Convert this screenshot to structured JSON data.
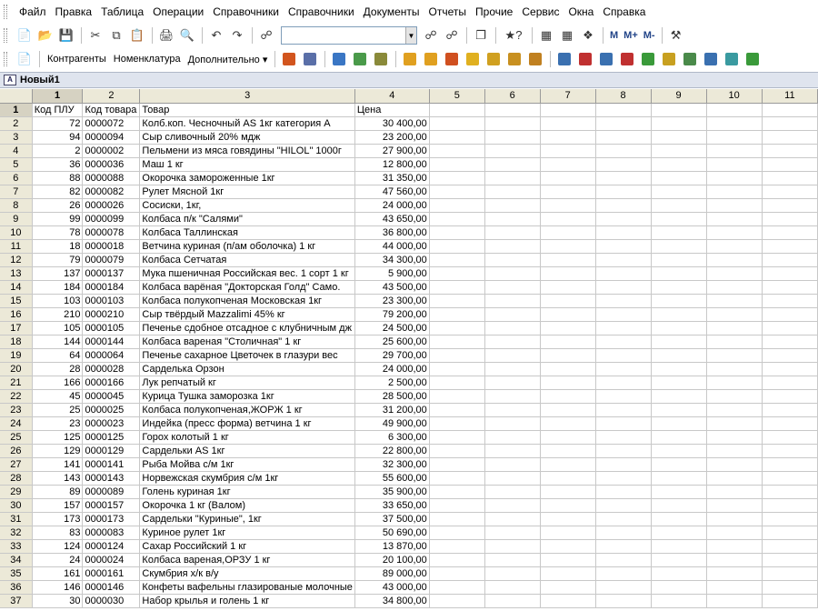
{
  "menu": [
    "Файл",
    "Правка",
    "Таблица",
    "Операции",
    "Справочники",
    "Справочники",
    "Документы",
    "Отчеты",
    "Прочие",
    "Сервис",
    "Окна",
    "Справка"
  ],
  "toolbar2": {
    "contractors": "Контрагенты",
    "nomenclature": "Номенклатура",
    "additional": "Дополнительно ▾"
  },
  "mbuttons": [
    "M",
    "M+",
    "M-"
  ],
  "document": {
    "title": "Новый1"
  },
  "columns": [
    "1",
    "2",
    "3",
    "4",
    "5",
    "6",
    "7",
    "8",
    "9",
    "10",
    "11"
  ],
  "header_row": {
    "num": "1",
    "cells": [
      "Код ПЛУ",
      "Код товара",
      "Товар",
      "Цена"
    ]
  },
  "rows": [
    {
      "n": "2",
      "plu": "72",
      "code": "0000072",
      "name": "Колб.коп. Чесночный AS 1кг категория А",
      "price": "30 400,00"
    },
    {
      "n": "3",
      "plu": "94",
      "code": "0000094",
      "name": "Сыр сливочный 20% мдж",
      "price": "23 200,00"
    },
    {
      "n": "4",
      "plu": "2",
      "code": "0000002",
      "name": "Пельмени из мяса говядины \"HILOL\" 1000г",
      "price": "27 900,00"
    },
    {
      "n": "5",
      "plu": "36",
      "code": "0000036",
      "name": "Маш 1 кг",
      "price": "12 800,00"
    },
    {
      "n": "6",
      "plu": "88",
      "code": "0000088",
      "name": "Окорочка замороженные 1кг",
      "price": "31 350,00"
    },
    {
      "n": "7",
      "plu": "82",
      "code": "0000082",
      "name": "Рулет Мясной 1кг",
      "price": "47 560,00"
    },
    {
      "n": "8",
      "plu": "26",
      "code": "0000026",
      "name": "Сосиски, 1кг,",
      "price": "24 000,00"
    },
    {
      "n": "9",
      "plu": "99",
      "code": "0000099",
      "name": "Колбаса п/к \"Салями\"",
      "price": "43 650,00"
    },
    {
      "n": "10",
      "plu": "78",
      "code": "0000078",
      "name": "Колбаса Таллинская",
      "price": "36 800,00"
    },
    {
      "n": "11",
      "plu": "18",
      "code": "0000018",
      "name": "Ветчина куриная (п/ам оболочка) 1 кг",
      "price": "44 000,00"
    },
    {
      "n": "12",
      "plu": "79",
      "code": "0000079",
      "name": "Колбаса Сетчатая",
      "price": "34 300,00"
    },
    {
      "n": "13",
      "plu": "137",
      "code": "0000137",
      "name": "Мука пшеничная Российская вес. 1 сорт 1 кг",
      "price": "5 900,00"
    },
    {
      "n": "14",
      "plu": "184",
      "code": "0000184",
      "name": "Колбаса варёная \"Докторская Голд\" Само.",
      "price": "43 500,00"
    },
    {
      "n": "15",
      "plu": "103",
      "code": "0000103",
      "name": "Колбаса полукопченая Московская 1кг",
      "price": "23 300,00"
    },
    {
      "n": "16",
      "plu": "210",
      "code": "0000210",
      "name": "Сыр твёрдый Mazzalimi 45% кг",
      "price": "79 200,00"
    },
    {
      "n": "17",
      "plu": "105",
      "code": "0000105",
      "name": "Печенье сдобное отсадное с клубничным дж",
      "price": "24 500,00"
    },
    {
      "n": "18",
      "plu": "144",
      "code": "0000144",
      "name": "Колбаса вареная \"Столичная\" 1 кг",
      "price": "25 600,00"
    },
    {
      "n": "19",
      "plu": "64",
      "code": "0000064",
      "name": "Печенье сахарное Цветочек в глазури вес",
      "price": "29 700,00"
    },
    {
      "n": "20",
      "plu": "28",
      "code": "0000028",
      "name": "Сарделька Орзон",
      "price": "24 000,00"
    },
    {
      "n": "21",
      "plu": "166",
      "code": "0000166",
      "name": "Лук репчатый кг",
      "price": "2 500,00"
    },
    {
      "n": "22",
      "plu": "45",
      "code": "0000045",
      "name": "Курица Тушка заморозка 1кг",
      "price": "28 500,00"
    },
    {
      "n": "23",
      "plu": "25",
      "code": "0000025",
      "name": "Колбаса полукопченая,ЖОРЖ 1 кг",
      "price": "31 200,00"
    },
    {
      "n": "24",
      "plu": "23",
      "code": "0000023",
      "name": "Индейка (пресс форма) ветчина 1 кг",
      "price": "49 900,00"
    },
    {
      "n": "25",
      "plu": "125",
      "code": "0000125",
      "name": "Горох колотый 1 кг",
      "price": "6 300,00"
    },
    {
      "n": "26",
      "plu": "129",
      "code": "0000129",
      "name": "Сардельки AS 1кг",
      "price": "22 800,00"
    },
    {
      "n": "27",
      "plu": "141",
      "code": "0000141",
      "name": "Рыба Мойва с/м 1кг",
      "price": "32 300,00"
    },
    {
      "n": "28",
      "plu": "143",
      "code": "0000143",
      "name": "Норвежская скумбрия с/м 1кг",
      "price": "55 600,00"
    },
    {
      "n": "29",
      "plu": "89",
      "code": "0000089",
      "name": "Голень куриная 1кг",
      "price": "35 900,00"
    },
    {
      "n": "30",
      "plu": "157",
      "code": "0000157",
      "name": "Окорочка 1 кг (Валом)",
      "price": "33 650,00"
    },
    {
      "n": "31",
      "plu": "173",
      "code": "0000173",
      "name": "Сардельки \"Куриные\", 1кг",
      "price": "37 500,00"
    },
    {
      "n": "32",
      "plu": "83",
      "code": "0000083",
      "name": "Куриное рулет 1кг",
      "price": "50 690,00"
    },
    {
      "n": "33",
      "plu": "124",
      "code": "0000124",
      "name": "Сахар Российский 1 кг",
      "price": "13 870,00"
    },
    {
      "n": "34",
      "plu": "24",
      "code": "0000024",
      "name": "Колбаса вареная,ОРЗУ 1 кг",
      "price": "20 100,00"
    },
    {
      "n": "35",
      "plu": "161",
      "code": "0000161",
      "name": "Скумбрия х/к в/у",
      "price": "89 000,00"
    },
    {
      "n": "36",
      "plu": "146",
      "code": "0000146",
      "name": "Конфеты вафельны глазированые молочные",
      "price": "43 000,00"
    },
    {
      "n": "37",
      "plu": "30",
      "code": "0000030",
      "name": "Набор крылья и голень 1 кг",
      "price": "34 800,00"
    }
  ]
}
